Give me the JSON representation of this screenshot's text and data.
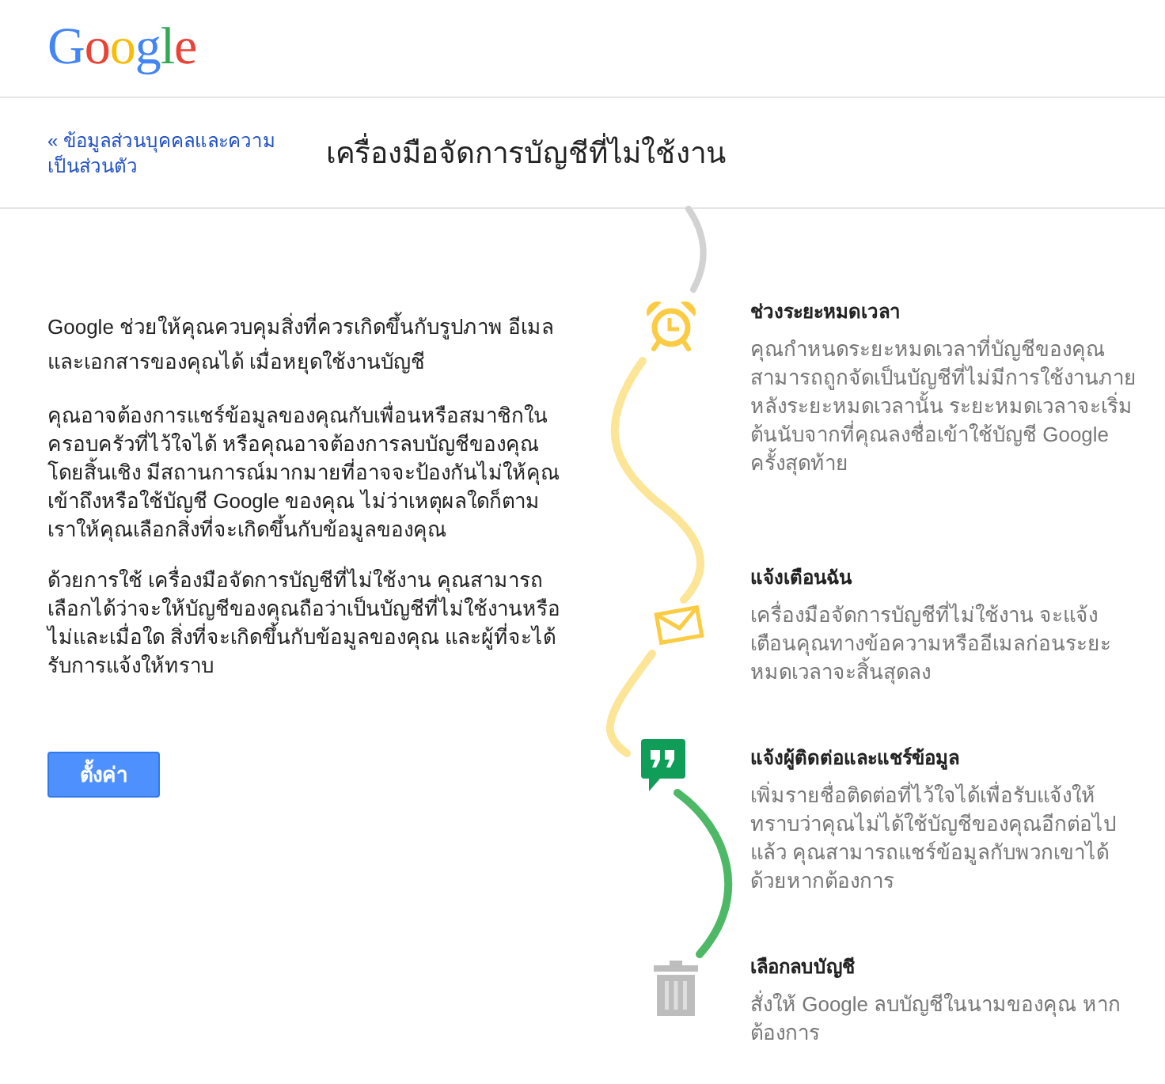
{
  "logo": "Google",
  "header": {
    "back_link": "« ข้อมูลส่วนบุคคลและความเป็นส่วนตัว",
    "title": "เครื่องมือจัดการบัญชีที่ไม่ใช้งาน"
  },
  "intro": {
    "paragraphs": [
      "Google ช่วยให้คุณควบคุมสิ่งที่ควรเกิดขึ้นกับรูปภาพ อีเมล และเอกสารของคุณได้ เมื่อหยุดใช้งานบัญชี",
      "คุณอาจต้องการแชร์ข้อมูลของคุณกับเพื่อนหรือสมาชิกในครอบครัวที่ไว้ใจได้ หรือคุณอาจต้องการลบบัญชีของคุณโดยสิ้นเชิง มีสถานการณ์มากมายที่อาจจะป้องกันไม่ให้คุณเข้าถึงหรือใช้บัญชี Google ของคุณ ไม่ว่าเหตุผลใดก็ตาม เราให้คุณเลือกสิ่งที่จะเกิดขึ้นกับข้อมูลของคุณ",
      "ด้วยการใช้ เครื่องมือจัดการบัญชีที่ไม่ใช้งาน คุณสามารถเลือกได้ว่าจะให้บัญชีของคุณถือว่าเป็นบัญชีที่ไม่ใช้งานหรือไม่และเมื่อใด สิ่งที่จะเกิดขึ้นกับข้อมูลของคุณ และผู้ที่จะได้รับการแจ้งให้ทราบ"
    ],
    "button": "ตั้งค่า"
  },
  "steps": [
    {
      "kind": "timeout",
      "title": "ช่วงระยะหมดเวลา",
      "description": "คุณกำหนดระยะหมดเวลาที่บัญชีของคุณสามารถถูกจัดเป็นบัญชีที่ไม่มีการใช้งานภายหลังระยะหมดเวลานั้น ระยะหมดเวลาจะเริ่มต้นนับจากที่คุณลงชื่อเข้าใช้บัญชี Google ครั้งสุดท้าย"
    },
    {
      "kind": "notify",
      "title": "แจ้งเตือนฉัน",
      "description": "เครื่องมือจัดการบัญชีที่ไม่ใช้งาน จะแจ้งเตือนคุณทางข้อความหรืออีเมลก่อนระยะหมดเวลาจะสิ้นสุดลง"
    },
    {
      "kind": "contacts",
      "title": "แจ้งผู้ติดต่อและแชร์ข้อมูล",
      "description": "เพิ่มรายชื่อติดต่อที่ไว้ใจได้เพื่อรับแจ้งให้ทราบว่าคุณไม่ได้ใช้บัญชีของคุณอีกต่อไปแล้ว คุณสามารถแชร์ข้อมูลกับพวกเขาได้ด้วยหากต้องการ"
    },
    {
      "kind": "delete",
      "title": "เลือกลบบัญชี",
      "description": "สั่งให้ Google ลบบัญชีในนามของคุณ หากต้องการ"
    }
  ]
}
